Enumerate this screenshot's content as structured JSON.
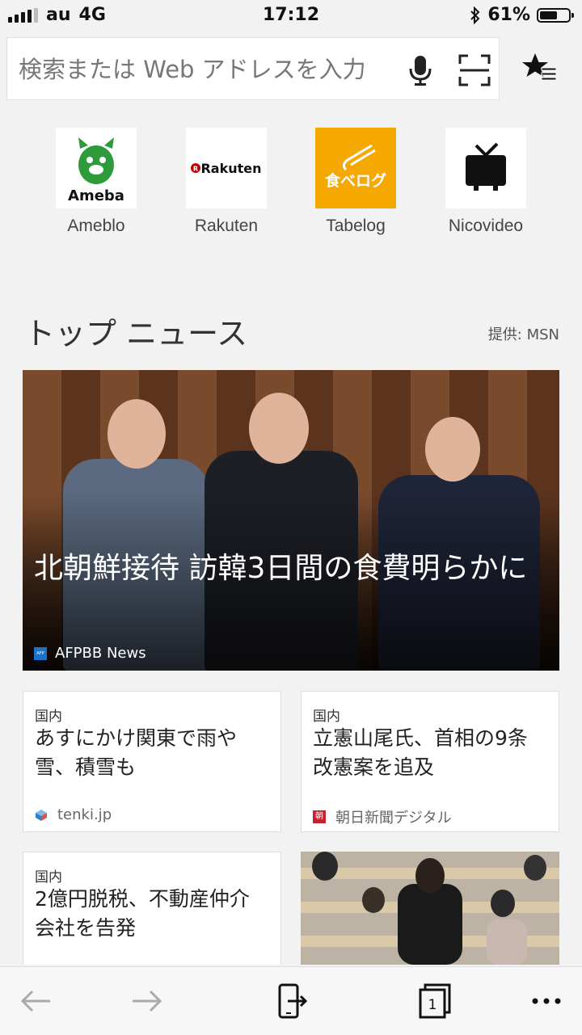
{
  "status_bar": {
    "carrier": "au",
    "network": "4G",
    "time": "17:12",
    "battery_percent": "61%",
    "battery_level": 0.61
  },
  "address_bar": {
    "placeholder": "検索または Web アドレスを入力"
  },
  "quick_links": [
    {
      "label": "Ameblo",
      "logo_text": "Ameba"
    },
    {
      "label": "Rakuten",
      "logo_text": "Rakuten"
    },
    {
      "label": "Tabelog",
      "logo_text": "食べログ"
    },
    {
      "label": "Nicovideo"
    }
  ],
  "news": {
    "section_title": "トップ ニュース",
    "provider": "提供: MSN",
    "hero": {
      "headline": "北朝鮮接待 訪韓3日間の食費明らかに",
      "source": "AFPBB News",
      "source_logo": "AFP"
    },
    "cards": [
      {
        "category": "国内",
        "title": "あすにかけ関東で雨や雪、積雪も",
        "source": "tenki.jp"
      },
      {
        "category": "国内",
        "title": "立憲山尾氏、首相の9条改憲案を追及",
        "source": "朝日新聞デジタル",
        "source_logo": "朝"
      },
      {
        "category": "国内",
        "title": "2億円脱税、不動産仲介会社を告発"
      }
    ]
  },
  "toolbar": {
    "back_icon": "arrow-left-icon",
    "forward_icon": "arrow-right-icon",
    "continue_icon": "phone-share-icon",
    "tabs_count": "1",
    "more_icon": "more-icon"
  },
  "colors": {
    "background": "#f2f2f2",
    "tabelog_orange": "#f5a800",
    "ameba_green": "#2e9b3a",
    "rakuten_red": "#bf0000"
  }
}
